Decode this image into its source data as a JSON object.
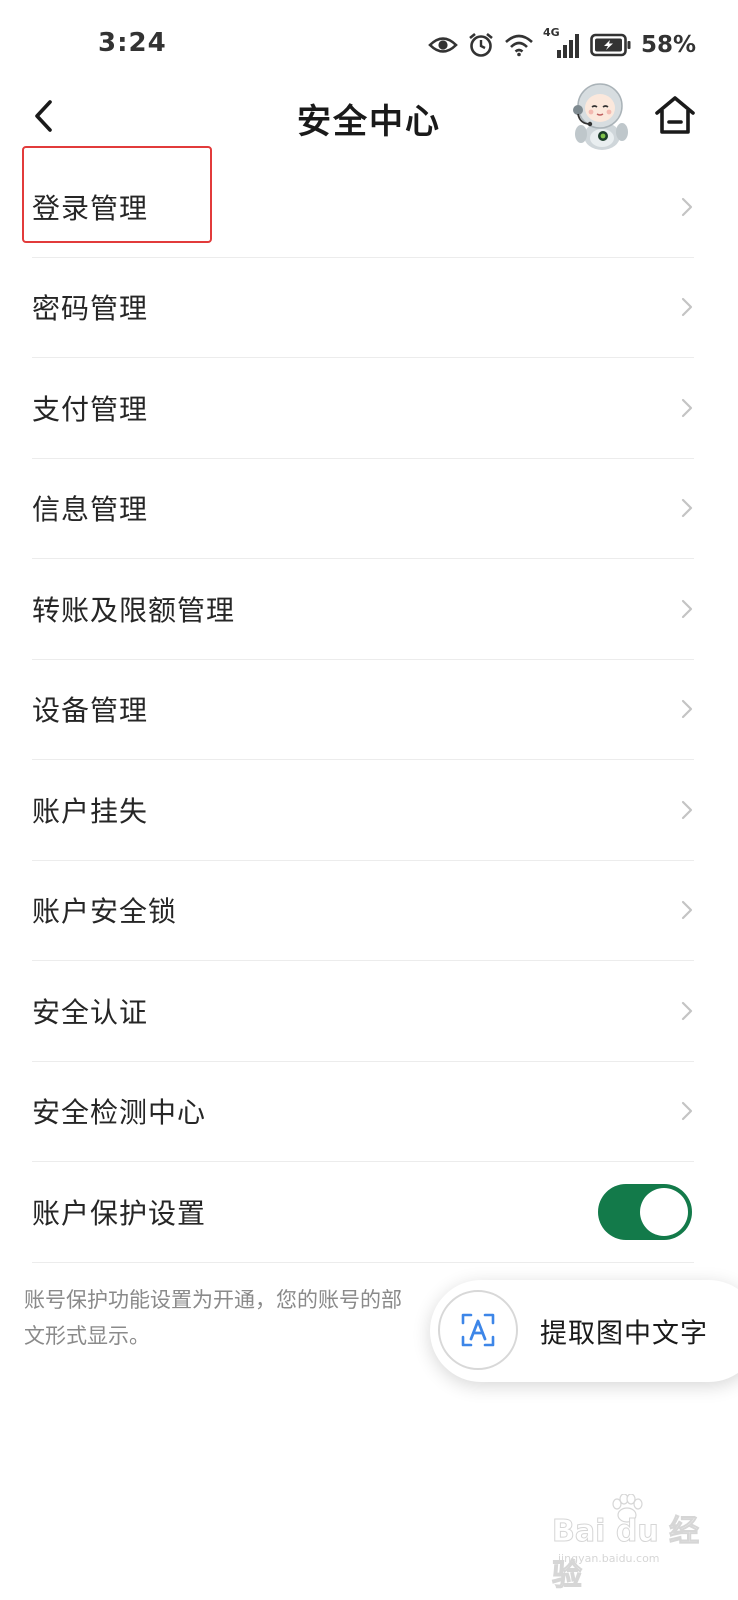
{
  "status_bar": {
    "time": "3:24",
    "network_label": "4G",
    "battery_percent": "58%",
    "icons": [
      "eye-icon",
      "alarm-icon",
      "wifi-icon",
      "signal-icon",
      "battery-charging-icon"
    ]
  },
  "header": {
    "title": "安全中心",
    "back_icon": "chevron-left-icon",
    "home_icon": "home-icon",
    "mascot": "astronaut-mascot"
  },
  "menu": {
    "items": [
      {
        "label": "登录管理",
        "type": "link"
      },
      {
        "label": "密码管理",
        "type": "link"
      },
      {
        "label": "支付管理",
        "type": "link"
      },
      {
        "label": "信息管理",
        "type": "link"
      },
      {
        "label": "转账及限额管理",
        "type": "link"
      },
      {
        "label": "设备管理",
        "type": "link"
      },
      {
        "label": "账户挂失",
        "type": "link"
      },
      {
        "label": "账户安全锁",
        "type": "link"
      },
      {
        "label": "安全认证",
        "type": "link"
      },
      {
        "label": "安全检测中心",
        "type": "link"
      },
      {
        "label": "账户保护设置",
        "type": "toggle",
        "enabled": true
      }
    ]
  },
  "footnote": {
    "line1": "账号保护功能设置为开通，您的账号的部",
    "line2": "文形式显示。"
  },
  "extract_text_button": {
    "label": "提取图中文字",
    "icon": "text-recognition-icon"
  },
  "watermark": {
    "brand": "Bai du 经验",
    "url": "jingyan.baidu.com"
  },
  "colors": {
    "accent_green": "#137a4a",
    "highlight_red": "#e23b3b",
    "divider": "#ececec",
    "footnote_gray": "#8a8a8a"
  }
}
